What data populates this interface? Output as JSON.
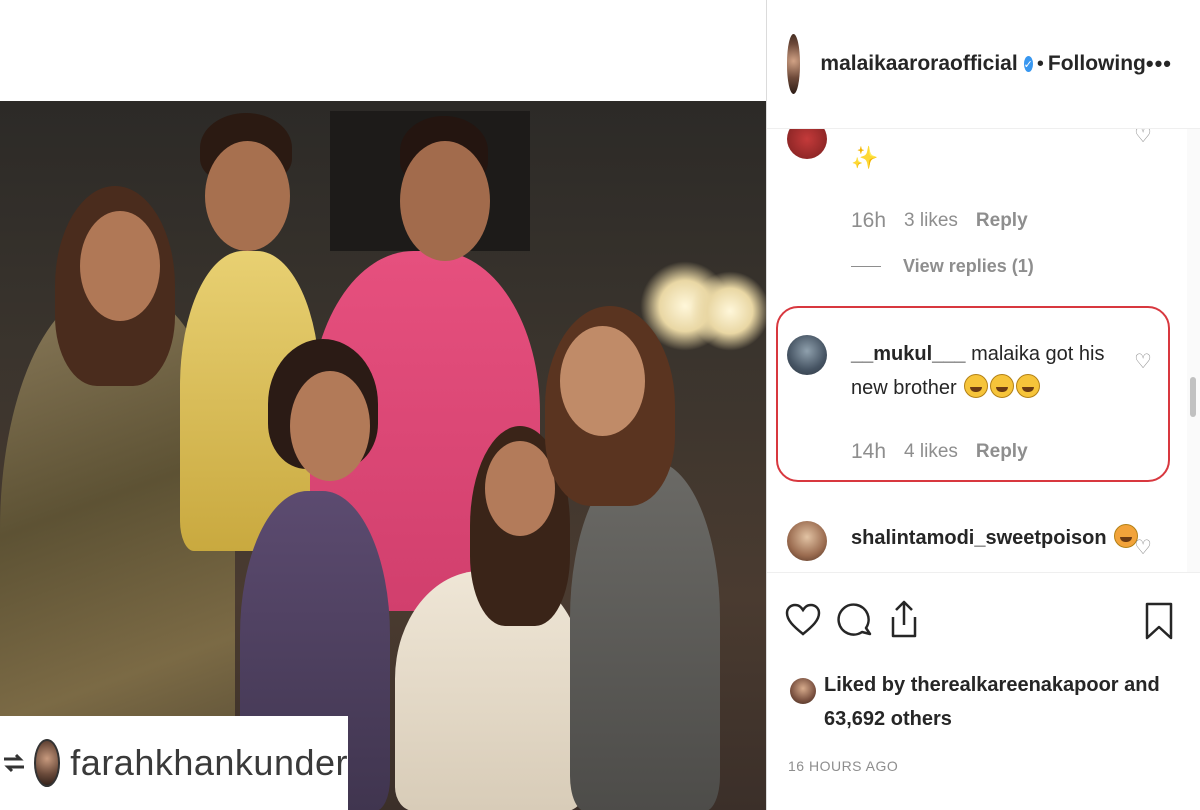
{
  "post": {
    "repost_credit": "farahkhankunder"
  },
  "header": {
    "username": "malaikaaroraofficial",
    "separator": "•",
    "follow_status": "Following",
    "more": "•••"
  },
  "comments": [
    {
      "text": "✨",
      "time": "16h",
      "likes": "3 likes",
      "reply": "Reply",
      "view_replies": "View replies (1)"
    },
    {
      "username": "__mukul___",
      "text": "malaika got his new brother",
      "time": "14h",
      "likes": "4 likes",
      "reply": "Reply",
      "highlighted": true
    },
    {
      "username": "shalintamodi_sweetpoison"
    }
  ],
  "actions": {
    "icons": [
      "heart-icon",
      "comment-icon",
      "share-icon",
      "bookmark-icon"
    ]
  },
  "likes": {
    "prefix": "Liked by",
    "user": "therealkareenakapoor",
    "and": "and",
    "count": "63,692 others"
  },
  "timestamp": "16 HOURS AGO",
  "colors": {
    "highlight_border": "#d8383f",
    "verified": "#3897f0",
    "meta_gray": "#8e8e8e"
  }
}
